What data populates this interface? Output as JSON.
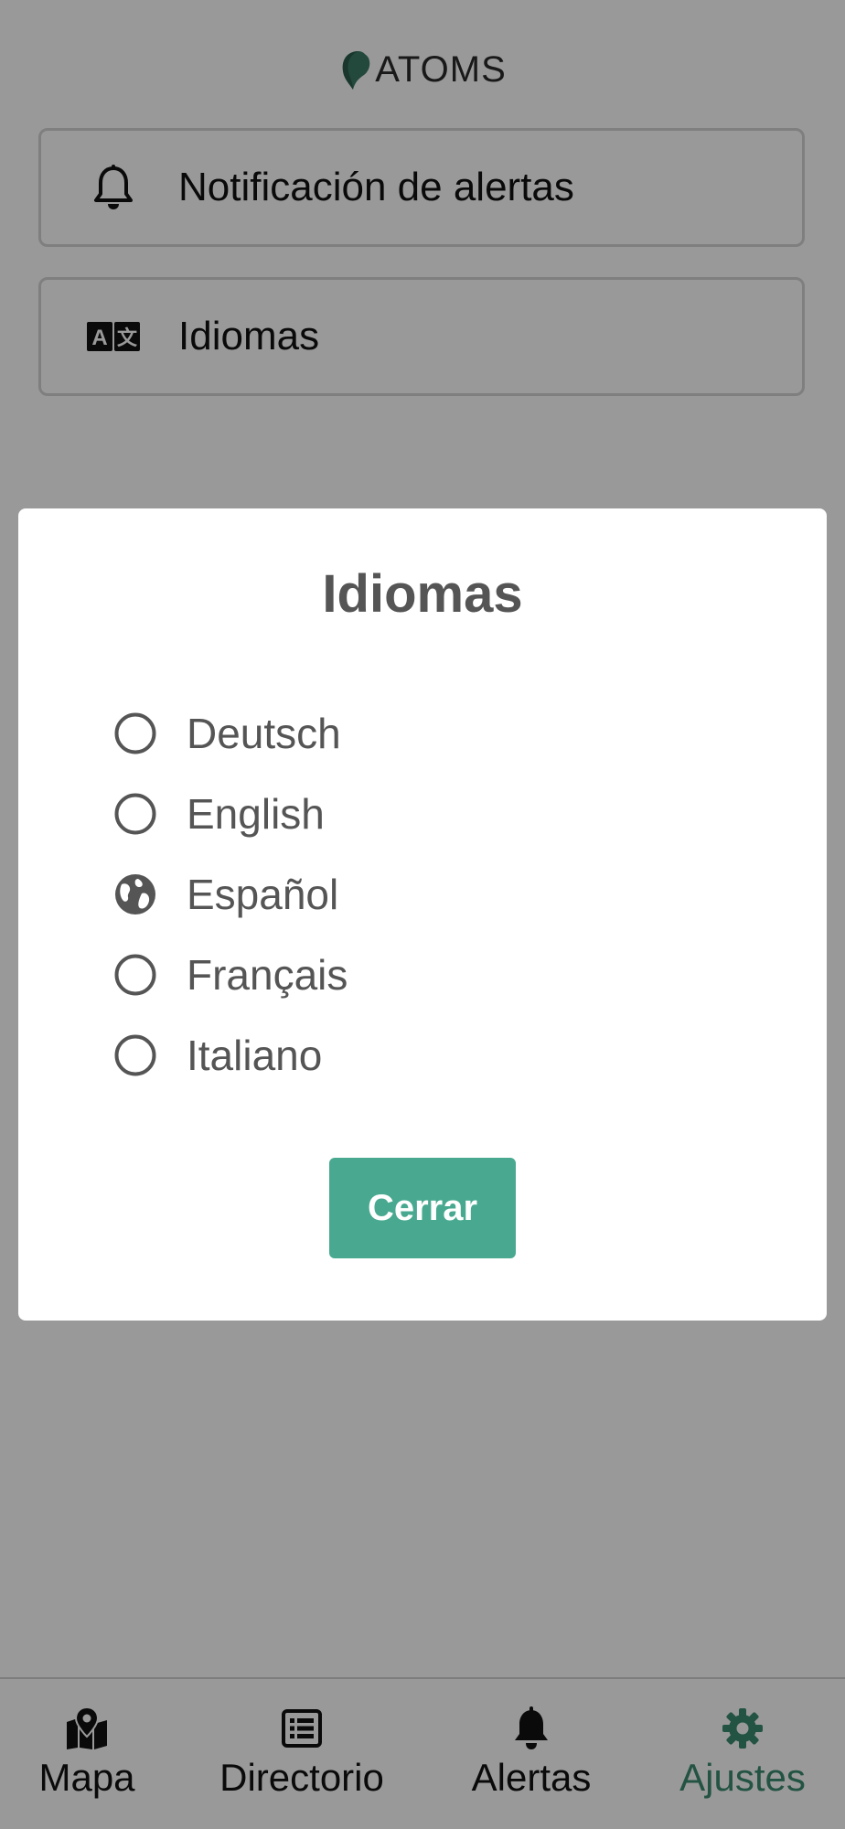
{
  "app": {
    "brand": "ATOMS",
    "accent_color": "#48a990",
    "brand_color": "#3b7a64"
  },
  "settings": {
    "items": [
      {
        "label": "Notificación de alertas",
        "icon": "bell-outline-icon"
      },
      {
        "label": "Idiomas",
        "icon": "translate-icon"
      }
    ]
  },
  "dialog": {
    "title": "Idiomas",
    "options": [
      {
        "label": "Deutsch",
        "selected": false
      },
      {
        "label": "English",
        "selected": false
      },
      {
        "label": "Español",
        "selected": true,
        "icon": "globe-icon"
      },
      {
        "label": "Français",
        "selected": false
      },
      {
        "label": "Italiano",
        "selected": false
      }
    ],
    "close_label": "Cerrar"
  },
  "nav": {
    "items": [
      {
        "label": "Mapa",
        "icon": "map-marker-icon"
      },
      {
        "label": "Directorio",
        "icon": "list-icon"
      },
      {
        "label": "Alertas",
        "icon": "bell-icon"
      },
      {
        "label": "Ajustes",
        "icon": "gear-icon",
        "active": true
      }
    ]
  }
}
